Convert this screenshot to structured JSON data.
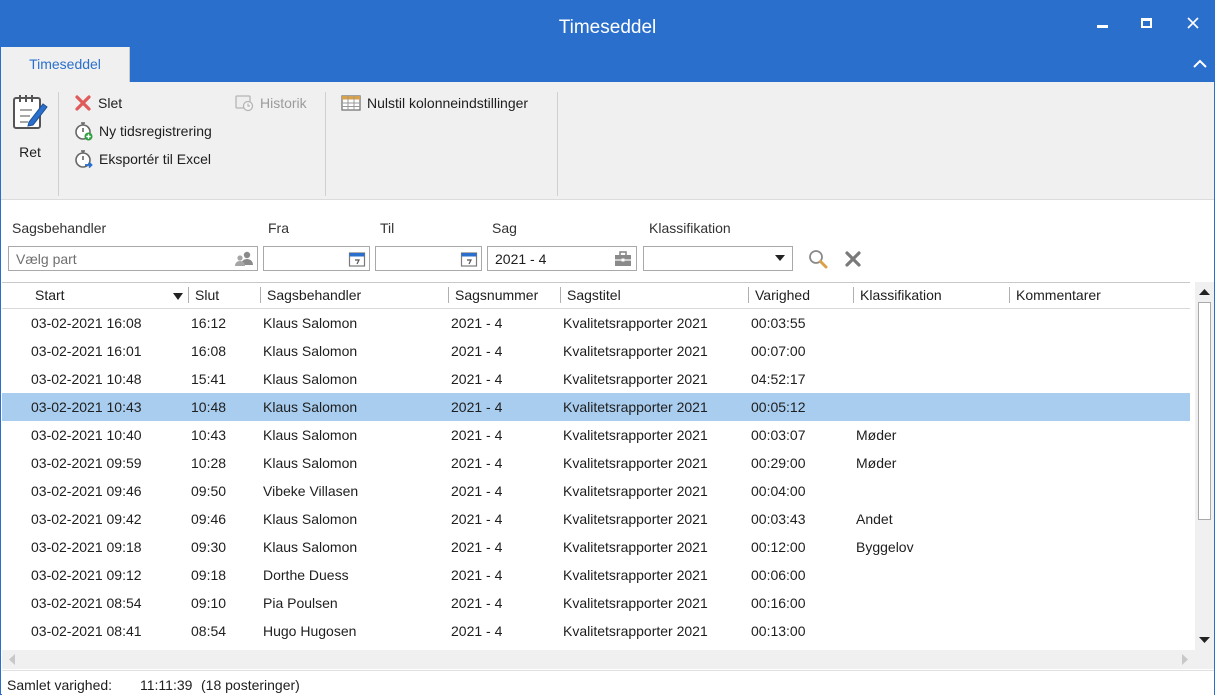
{
  "window": {
    "title": "Timeseddel"
  },
  "ribbon": {
    "tab": "Timeseddel",
    "ret_label": "Ret",
    "slet_label": "Slet",
    "ny_label": "Ny tidsregistrering",
    "eksporter_label": "Eksportér til Excel",
    "historik_label": "Historik",
    "nulstil_label": "Nulstil kolonneindstillinger"
  },
  "filters": {
    "sagsbehandler_label": "Sagsbehandler",
    "sagsbehandler_placeholder": "Vælg part",
    "fra_label": "Fra",
    "fra_value": "",
    "til_label": "Til",
    "til_value": "",
    "sag_label": "Sag",
    "sag_value": "2021 - 4",
    "klassifikation_label": "Klassifikation",
    "klassifikation_value": ""
  },
  "grid": {
    "columns": [
      "Start",
      "Slut",
      "Sagsbehandler",
      "Sagsnummer",
      "Sagstitel",
      "Varighed",
      "Klassifikation",
      "Kommentarer"
    ],
    "sort_column": "Start",
    "selected_row": 3,
    "rows": [
      [
        "03-02-2021 16:08",
        "16:12",
        "Klaus Salomon",
        "2021 - 4",
        "Kvalitetsrapporter 2021",
        "00:03:55",
        "",
        ""
      ],
      [
        "03-02-2021 16:01",
        "16:08",
        "Klaus Salomon",
        "2021 - 4",
        "Kvalitetsrapporter 2021",
        "00:07:00",
        "",
        ""
      ],
      [
        "03-02-2021 10:48",
        "15:41",
        "Klaus Salomon",
        "2021 - 4",
        "Kvalitetsrapporter 2021",
        "04:52:17",
        "",
        ""
      ],
      [
        "03-02-2021 10:43",
        "10:48",
        "Klaus Salomon",
        "2021 - 4",
        "Kvalitetsrapporter 2021",
        "00:05:12",
        "",
        ""
      ],
      [
        "03-02-2021 10:40",
        "10:43",
        "Klaus Salomon",
        "2021 - 4",
        "Kvalitetsrapporter 2021",
        "00:03:07",
        "Møder",
        ""
      ],
      [
        "03-02-2021 09:59",
        "10:28",
        "Klaus Salomon",
        "2021 - 4",
        "Kvalitetsrapporter 2021",
        "00:29:00",
        "Møder",
        ""
      ],
      [
        "03-02-2021 09:46",
        "09:50",
        "Vibeke Villasen",
        "2021 - 4",
        "Kvalitetsrapporter 2021",
        "00:04:00",
        "",
        ""
      ],
      [
        "03-02-2021 09:42",
        "09:46",
        "Klaus Salomon",
        "2021 - 4",
        "Kvalitetsrapporter 2021",
        "00:03:43",
        "Andet",
        ""
      ],
      [
        "03-02-2021 09:18",
        "09:30",
        "Klaus Salomon",
        "2021 - 4",
        "Kvalitetsrapporter 2021",
        "00:12:00",
        "Byggelov",
        ""
      ],
      [
        "03-02-2021 09:12",
        "09:18",
        "Dorthe Duess",
        "2021 - 4",
        "Kvalitetsrapporter 2021",
        "00:06:00",
        "",
        ""
      ],
      [
        "03-02-2021 08:54",
        "09:10",
        "Pia Poulsen",
        "2021 - 4",
        "Kvalitetsrapporter 2021",
        "00:16:00",
        "",
        ""
      ],
      [
        "03-02-2021 08:41",
        "08:54",
        "Hugo Hugosen",
        "2021 - 4",
        "Kvalitetsrapporter 2021",
        "00:13:00",
        "",
        ""
      ]
    ]
  },
  "status": {
    "label": "Samlet varighed:",
    "total": "11:11:39",
    "count": "(18 posteringer)"
  },
  "colors": {
    "accent": "#2a6fcc",
    "selected_row": "#a9cdef",
    "ribbon_bg": "#f0f0f0",
    "delete_red": "#e05a5a"
  }
}
